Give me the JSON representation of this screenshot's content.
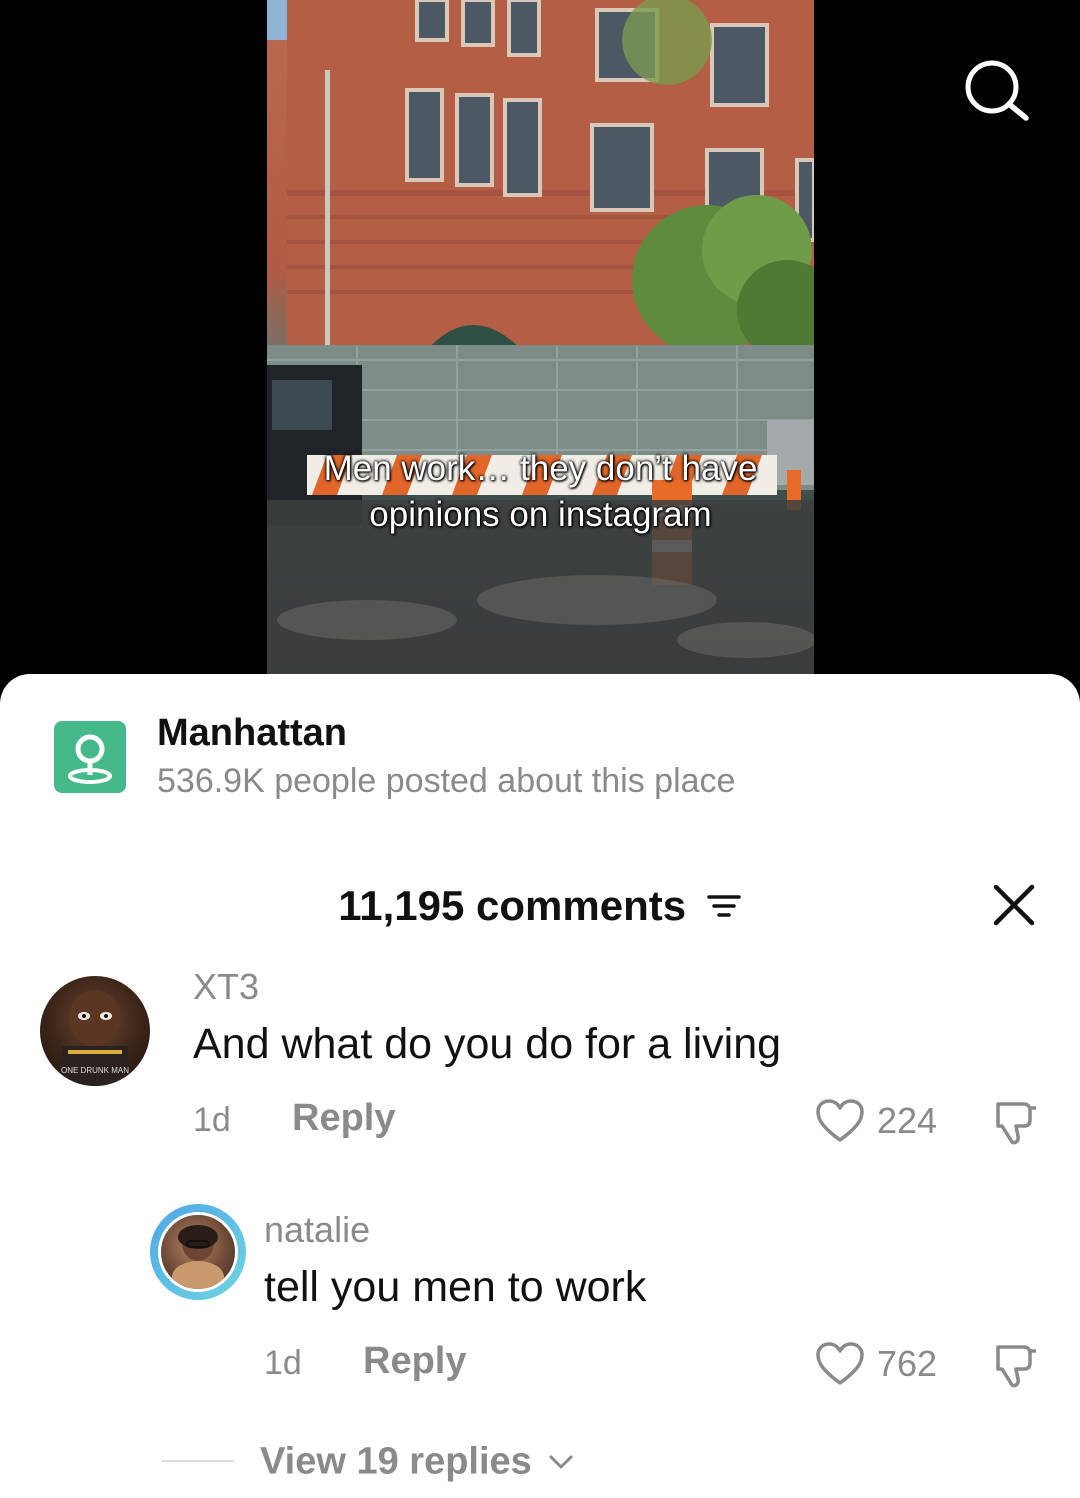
{
  "video": {
    "caption": "Men work… they don’t have opinions on instagram",
    "search_icon": "search-icon"
  },
  "place": {
    "icon": "location-pin-icon",
    "name": "Manhattan",
    "subtitle": "536.9K people posted about this place"
  },
  "comments_header": {
    "count_label": "11,195 comments",
    "filter_icon": "filter-icon",
    "close_icon": "close-icon"
  },
  "comments": [
    {
      "username": "XT3",
      "text": "And what do you do for a living",
      "time": "1d",
      "reply_label": "Reply",
      "likes": "224",
      "avatar_caption": "ONE DRUNK MAN"
    },
    {
      "username": "natalie",
      "text": "tell you men to work",
      "time": "1d",
      "reply_label": "Reply",
      "likes": "762"
    }
  ],
  "view_replies": {
    "label": "View 19 replies"
  },
  "colors": {
    "accent_place": "#46b98a",
    "muted_text": "#8a8a8a",
    "primary_text": "#111111",
    "story_ring": "#4fa6e8"
  }
}
